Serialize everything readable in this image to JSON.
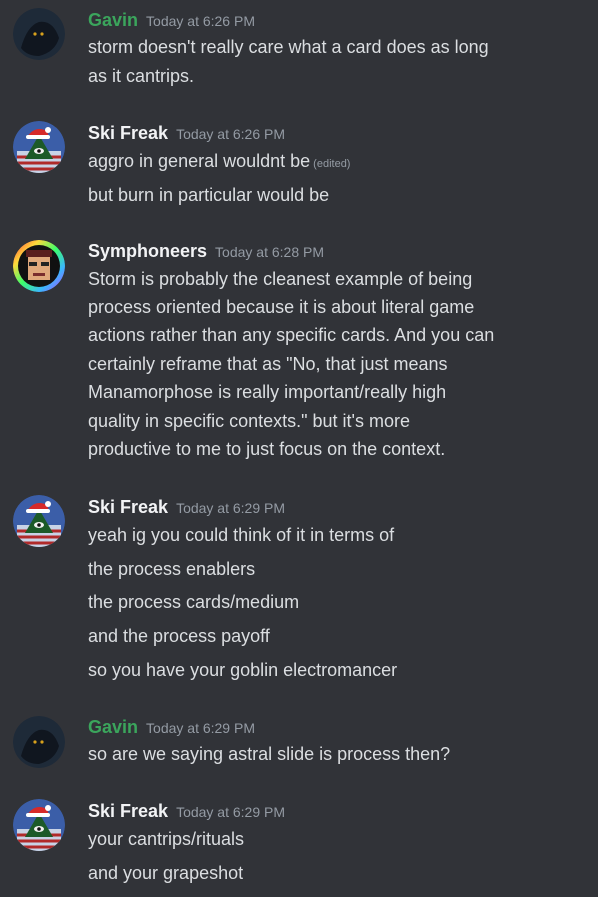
{
  "messages": [
    {
      "author": "Gavin",
      "timestamp": "Today at 6:26 PM",
      "avatar": "dark-creature-avatar",
      "lines": [
        "storm doesn't really care what a card does as long",
        "as it cantrips."
      ]
    },
    {
      "author": "Ski Freak",
      "timestamp": "Today at 6:26 PM",
      "avatar": "illuminati-santa-hat-avatar",
      "lines": [
        "aggro in general wouldnt be",
        "but burn in particular would be"
      ],
      "edited": "(edited)"
    },
    {
      "author": "Symphoneers",
      "timestamp": "Today at 6:28 PM",
      "avatar": "pixel-face-rainbow-avatar",
      "lines": [
        "Storm is probably the cleanest example of being",
        "process oriented because it is about literal game",
        "actions rather than any specific cards. And you can",
        "certainly reframe that as \"No, that just means",
        "Manamorphose is really important/really high",
        "quality in specific contexts.\" but it's more",
        "productive to me to just focus on the context."
      ]
    },
    {
      "author": "Ski Freak",
      "timestamp": "Today at 6:29 PM",
      "avatar": "illuminati-santa-hat-avatar",
      "lines": [
        "yeah ig you could think of it in terms of",
        "the process enablers",
        "the process cards/medium",
        "and the process payoff",
        "so you have your goblin electromancer"
      ]
    },
    {
      "author": "Gavin",
      "timestamp": "Today at 6:29 PM",
      "avatar": "dark-creature-avatar",
      "lines": [
        "so are we saying astral slide is process then?"
      ]
    },
    {
      "author": "Ski Freak",
      "timestamp": "Today at 6:29 PM",
      "avatar": "illuminati-santa-hat-avatar",
      "lines": [
        "your cantrips/rituals",
        "and your grapeshot"
      ]
    }
  ],
  "colors": {
    "background": "#313338",
    "text": "#dbdee1",
    "timestamp": "#949ba4",
    "gavin_name": "#3ba55c"
  }
}
